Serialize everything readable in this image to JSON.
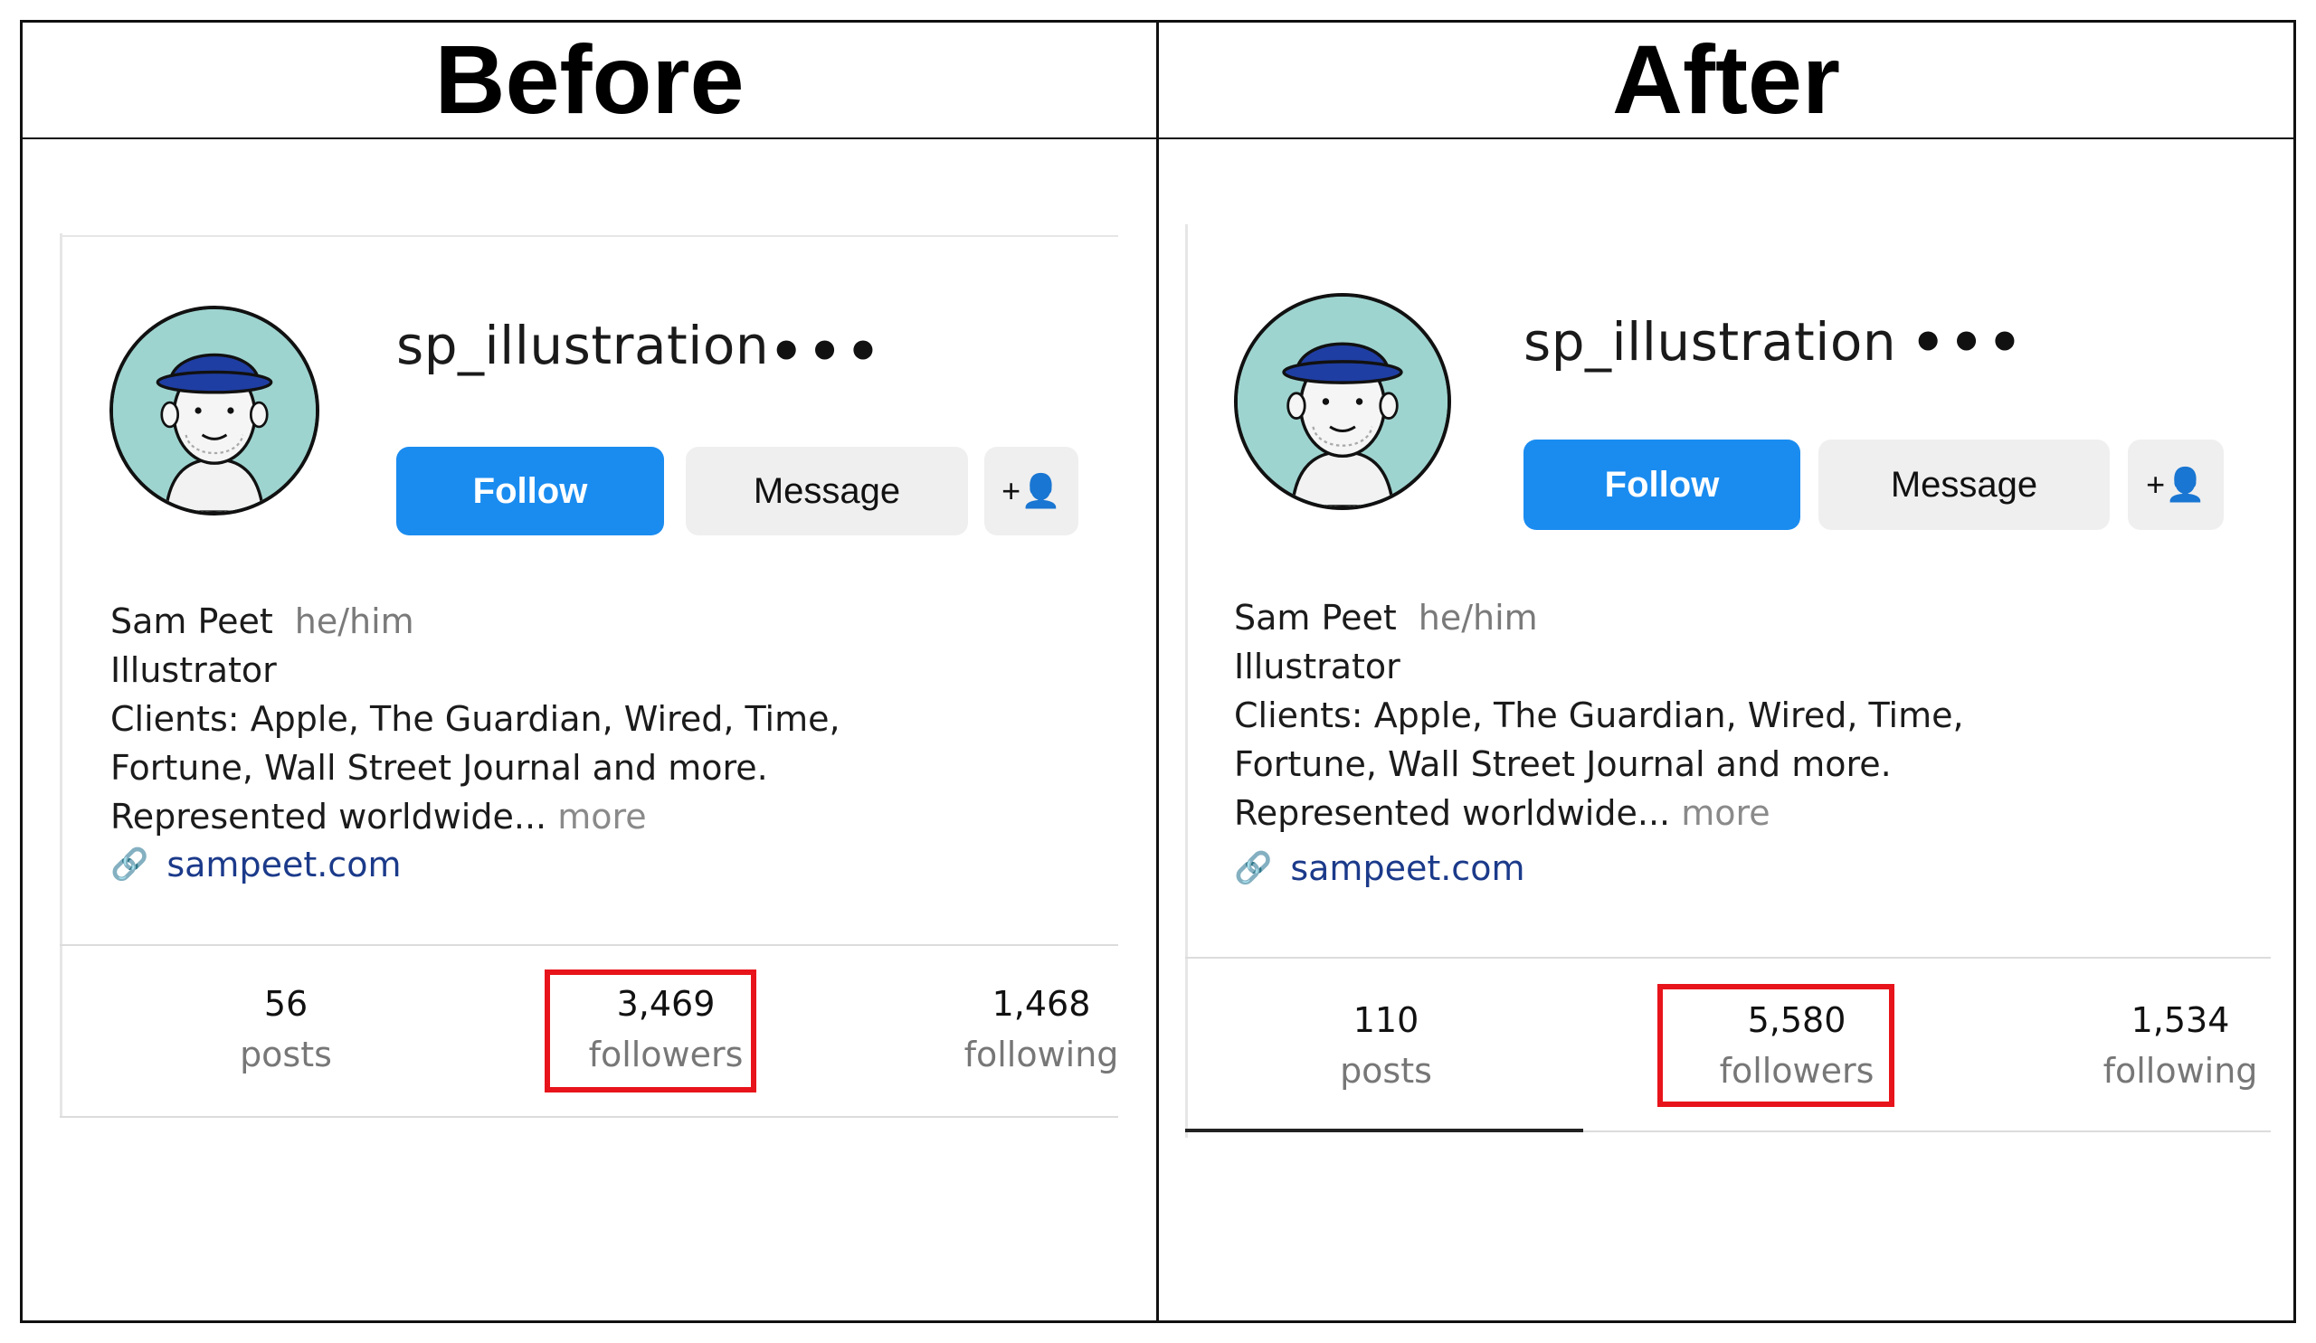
{
  "headings": {
    "before": "Before",
    "after": "After"
  },
  "before": {
    "username": "sp_illustration",
    "more": "•••",
    "follow": "Follow",
    "message": "Message",
    "add_user": "+👤",
    "name": "Sam Peet",
    "pronouns": "he/him",
    "bio": [
      "Illustrator",
      "Clients: Apple, The Guardian, Wired, Time,",
      "Fortune, Wall Street Journal and more."
    ],
    "bio_last": "Represented worldwide...",
    "more_link": "more",
    "website": "sampeet.com",
    "stats": {
      "posts": {
        "value": "56",
        "label": "posts"
      },
      "followers": {
        "value": "3,469",
        "label": "followers"
      },
      "following": {
        "value": "1,468",
        "label": "following"
      }
    }
  },
  "after": {
    "username": "sp_illustration",
    "more": "•••",
    "follow": "Follow",
    "message": "Message",
    "add_user": "+👤",
    "name": "Sam Peet",
    "pronouns": "he/him",
    "bio": [
      "Illustrator",
      "Clients: Apple, The Guardian, Wired, Time,",
      "Fortune, Wall Street Journal and more."
    ],
    "bio_last": "Represented worldwide...",
    "more_link": "more",
    "website": "sampeet.com",
    "stats": {
      "posts": {
        "value": "110",
        "label": "posts"
      },
      "followers": {
        "value": "5,580",
        "label": "followers"
      },
      "following": {
        "value": "1,534",
        "label": "following"
      }
    }
  },
  "colors": {
    "follow_button": "#1a8cf0",
    "highlight": "#e8141b",
    "link": "#1b3a8a",
    "avatar_bg": "#9ed4d0"
  }
}
